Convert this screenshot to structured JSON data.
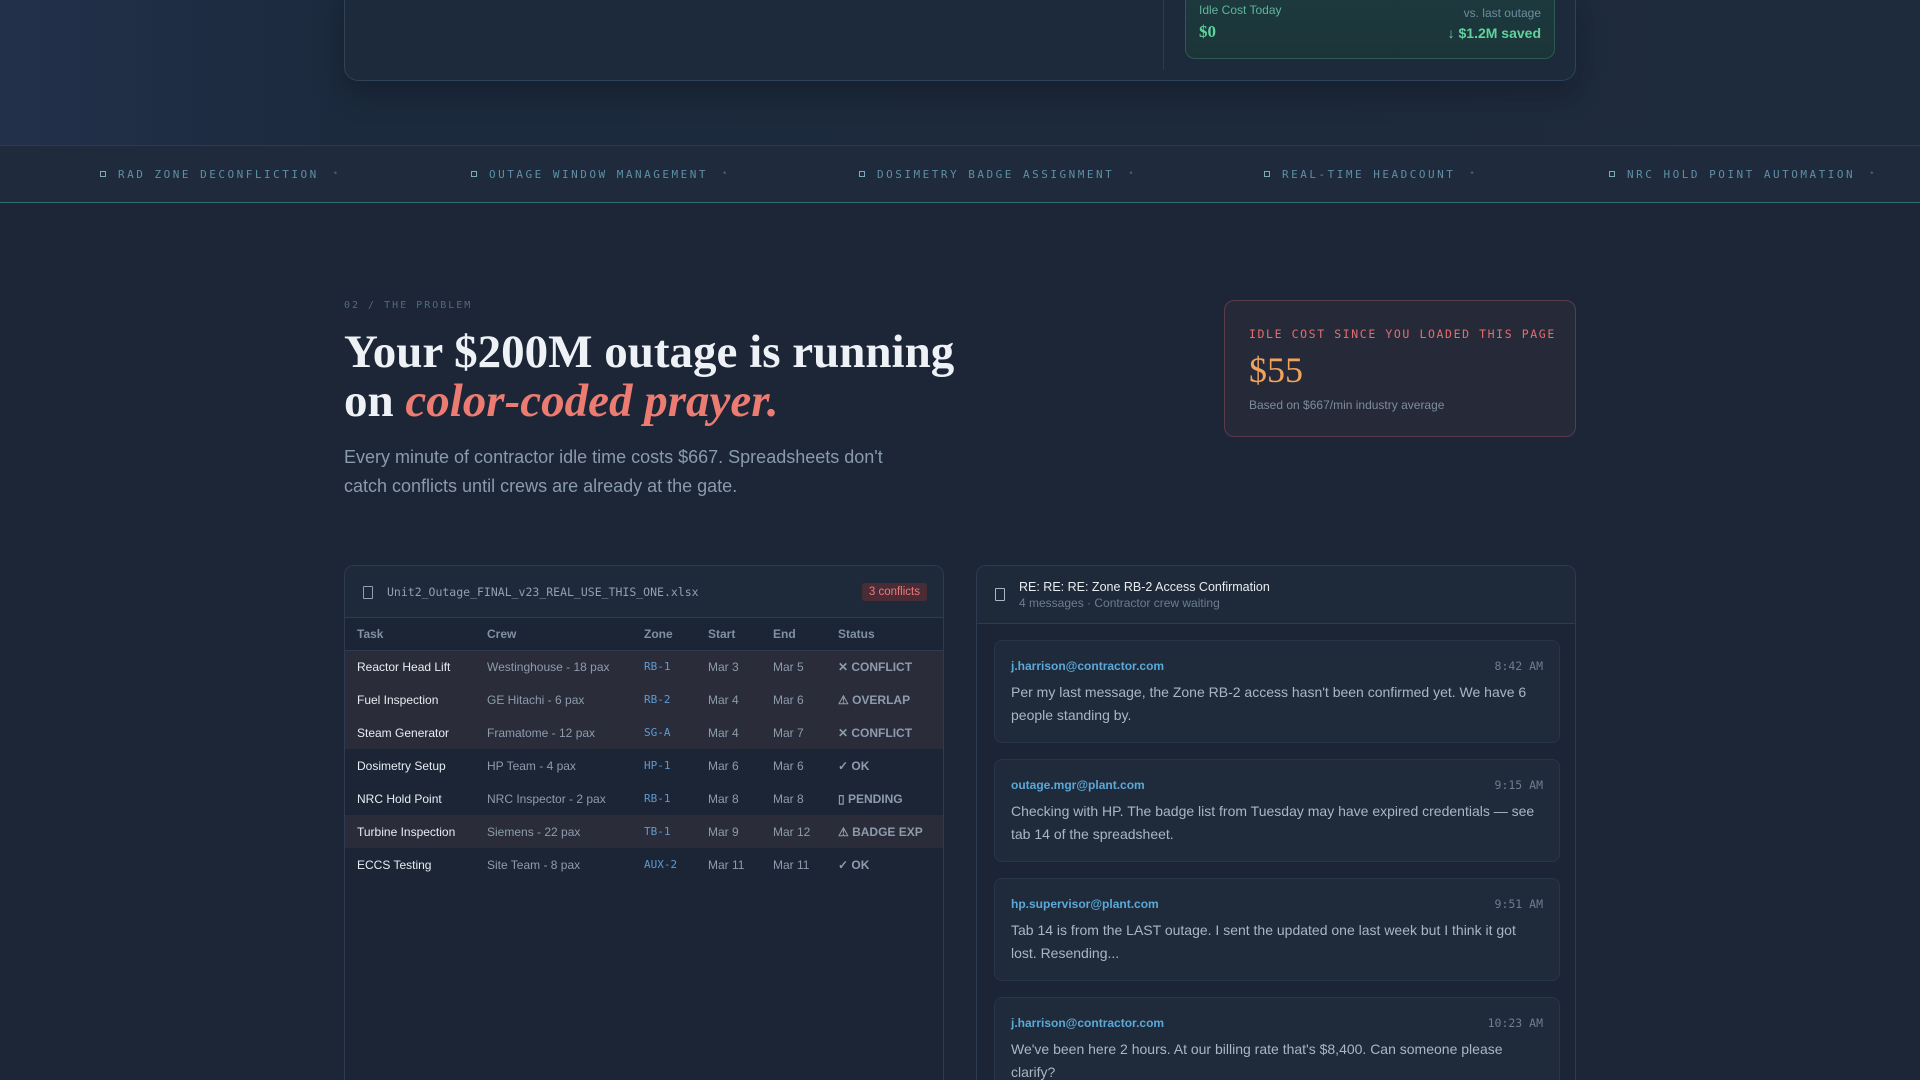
{
  "hero": {
    "idle_today_label": "Idle Cost Today",
    "idle_today_value": "$0",
    "vs_label": "vs. last outage",
    "saved_label": "↓ $1.2M saved"
  },
  "ticker": {
    "items": [
      "RAD ZONE DECONFLICTION",
      "OUTAGE WINDOW MANAGEMENT",
      "DOSIMETRY BADGE ASSIGNMENT",
      "REAL-TIME HEADCOUNT",
      "NRC HOLD POINT AUTOMATION"
    ],
    "separator": "•"
  },
  "problem": {
    "eyebrow": "02 / THE PROBLEM",
    "headline_main": "Your $200M outage is running on ",
    "headline_accent": "color-coded prayer.",
    "subcopy": "Every minute of contractor idle time costs $667. Spreadsheets don't catch conflicts until crews are already at the gate."
  },
  "idle_counter": {
    "label": "IDLE COST SINCE YOU LOADED THIS PAGE",
    "value": "$55",
    "note": "Based on $667/min industry average"
  },
  "spreadsheet": {
    "filename": "Unit2_Outage_FINAL_v23_REAL_USE_THIS_ONE.xlsx",
    "conflicts_badge": "3 conflicts",
    "columns": [
      "Task",
      "Crew",
      "Zone",
      "Start",
      "End",
      "Status"
    ],
    "rows": [
      {
        "task": "Reactor Head Lift",
        "crew": "Westinghouse - 18 pax",
        "zone": "RB-1",
        "start": "Mar 3",
        "end": "Mar 5",
        "status": "✕ CONFLICT",
        "kind": "conflict"
      },
      {
        "task": "Fuel Inspection",
        "crew": "GE Hitachi - 6 pax",
        "zone": "RB-2",
        "start": "Mar 4",
        "end": "Mar 6",
        "status": "⚠ OVERLAP",
        "kind": "overlap"
      },
      {
        "task": "Steam Generator",
        "crew": "Framatome - 12 pax",
        "zone": "SG-A",
        "start": "Mar 4",
        "end": "Mar 7",
        "status": "✕ CONFLICT",
        "kind": "conflict"
      },
      {
        "task": "Dosimetry Setup",
        "crew": "HP Team - 4 pax",
        "zone": "HP-1",
        "start": "Mar 6",
        "end": "Mar 6",
        "status": "✓ OK",
        "kind": "ok"
      },
      {
        "task": "NRC Hold Point",
        "crew": "NRC Inspector - 2 pax",
        "zone": "RB-1",
        "start": "Mar 8",
        "end": "Mar 8",
        "status": "▯ PENDING",
        "kind": "pending"
      },
      {
        "task": "Turbine Inspection",
        "crew": "Siemens - 22 pax",
        "zone": "TB-1",
        "start": "Mar 9",
        "end": "Mar 12",
        "status": "⚠ BADGE EXP",
        "kind": "badge"
      },
      {
        "task": "ECCS Testing",
        "crew": "Site Team - 8 pax",
        "zone": "AUX-2",
        "start": "Mar 11",
        "end": "Mar 11",
        "status": "✓ OK",
        "kind": "ok"
      }
    ]
  },
  "thread": {
    "subject": "RE: RE: RE: Zone RB-2 Access Confirmation",
    "meta": "4 messages · Contractor crew waiting",
    "messages": [
      {
        "from": "j.harrison@contractor.com",
        "time": "8:42 AM",
        "body": "Per my last message, the Zone RB-2 access hasn't been confirmed yet. We have 6 people standing by."
      },
      {
        "from": "outage.mgr@plant.com",
        "time": "9:15 AM",
        "body": "Checking with HP. The badge list from Tuesday may have expired credentials — see tab 14 of the spreadsheet."
      },
      {
        "from": "hp.supervisor@plant.com",
        "time": "9:51 AM",
        "body": "Tab 14 is from the LAST outage. I sent the updated one last week but I think it got lost. Resending..."
      },
      {
        "from": "j.harrison@contractor.com",
        "time": "10:23 AM",
        "body": "We've been here 2 hours. At our billing rate that's $8,400. Can someone please clarify?"
      }
    ]
  }
}
